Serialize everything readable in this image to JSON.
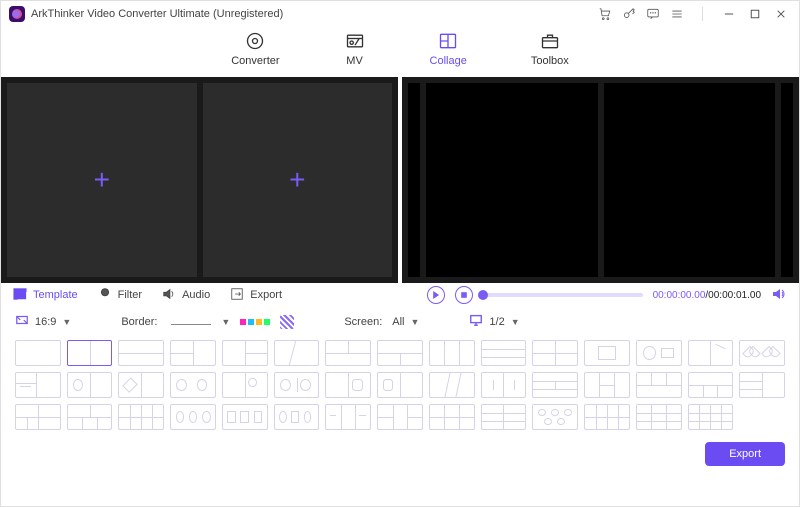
{
  "titlebar": {
    "app_name": "ArkThinker Video Converter Ultimate (Unregistered)"
  },
  "nav": {
    "converter": "Converter",
    "mv": "MV",
    "collage": "Collage",
    "toolbox": "Toolbox"
  },
  "mid": {
    "template": "Template",
    "filter": "Filter",
    "audio": "Audio",
    "export": "Export"
  },
  "player": {
    "time_current": "00:00:00.00",
    "time_total": "00:00:01.00"
  },
  "options": {
    "ratio": "16:9",
    "border_label": "Border:",
    "screen_label": "Screen:",
    "screen_value": "All",
    "page_value": "1/2"
  },
  "footer": {
    "export_label": "Export"
  }
}
